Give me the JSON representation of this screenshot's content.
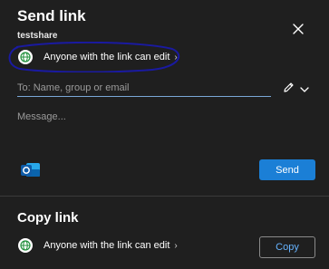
{
  "dialog": {
    "title": "Send link",
    "subtitle": "testshare",
    "close_icon": "close-icon"
  },
  "permission": {
    "label": "Anyone with the link can edit",
    "icon": "globe-icon",
    "chevron": "›"
  },
  "to_field": {
    "placeholder": "To: Name, group or email"
  },
  "message": {
    "placeholder": "Message..."
  },
  "send": {
    "label": "Send"
  },
  "copy_section": {
    "title": "Copy link",
    "permission_label": "Anyone with the link can edit",
    "chevron": "›",
    "copy_label": "Copy"
  },
  "colors": {
    "background": "#1f1f1f",
    "accent": "#1b7fd6",
    "copy_text": "#66b3ff",
    "annotation": "#1a1aa0"
  }
}
